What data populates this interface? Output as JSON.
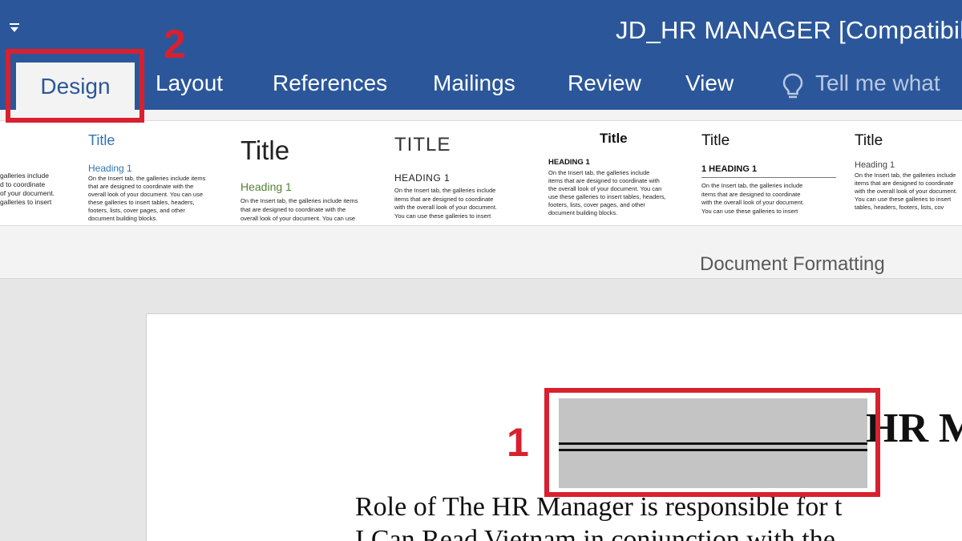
{
  "window": {
    "title": "JD_HR MANAGER [Compatibilit"
  },
  "ribbon": {
    "tabs": [
      {
        "label": "Design",
        "active": true
      },
      {
        "label": "Layout"
      },
      {
        "label": "References"
      },
      {
        "label": "Mailings"
      },
      {
        "label": "Review"
      },
      {
        "label": "View"
      }
    ],
    "tell_me": "Tell me what",
    "group_label": "Document Formatting",
    "style_sets": [
      {
        "title": "",
        "heading": "",
        "body": "galleries include\nd to coordinate\nof your document.\ngalleries to insert"
      },
      {
        "title": "Title",
        "heading": "Heading 1",
        "body": "On the Insert tab, the galleries include items\nthat are designed to coordinate with the\noverall look of your document. You can use\nthese galleries to insert tables, headers,\nfooters, lists, cover pages, and other\ndocument building blocks."
      },
      {
        "title": "Title",
        "heading": "Heading 1",
        "body": "On the Insert tab, the galleries include items\nthat are designed to coordinate with the\noverall look of your document. You can use"
      },
      {
        "title": "TITLE",
        "heading": "HEADING 1",
        "body": "On the Insert tab, the galleries include\nitems that are designed to coordinate\nwith the overall look of your document.\nYou can use these galleries to insert"
      },
      {
        "title": "Title",
        "heading": "HEADING 1",
        "body": "On the Insert tab, the galleries include\nitems that are designed to coordinate with\nthe overall look of your document. You can\nuse these galleries to insert tables, headers,\nfooters, lists, cover pages, and other\ndocument building blocks."
      },
      {
        "title": "Title",
        "heading": "1   HEADING 1",
        "body": "On the Insert tab, the galleries include\nitems that are designed to coordinate\nwith the overall look of your document.\nYou can use these galleries to insert"
      },
      {
        "title": "Title",
        "heading": "Heading 1",
        "body": "On the Insert tab, the galleries include\nitems that are designed to coordinate\nwith the overall look of your document.\nYou can use these galleries to insert\ntables, headers, footers, lists, cov"
      }
    ]
  },
  "document": {
    "heading_fragment": "HR M",
    "line1": "Role of The HR Manager is responsible for t",
    "line2": "I Can Read Vietnam in conjunction with the"
  },
  "annotations": {
    "marker_1": "1",
    "marker_2": "2"
  },
  "colors": {
    "ribbon_blue": "#2b579a",
    "annotation_red": "#d9202e",
    "heading_green": "#548235",
    "heading_blue": "#2e74b5"
  }
}
